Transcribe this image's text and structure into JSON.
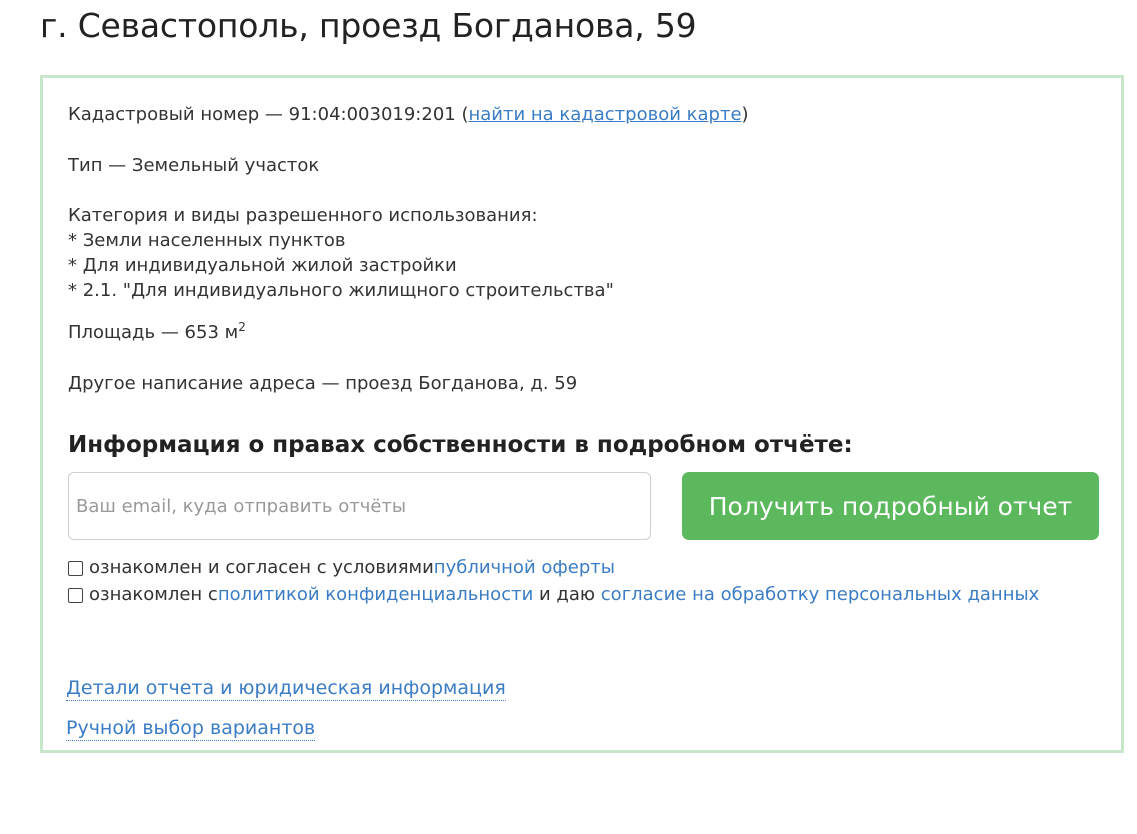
{
  "header": {
    "title": "г. Севастополь, проезд Богданова, 59"
  },
  "property": {
    "cadastral_label": "Кадастровый номер — 91:04:003019:201 (",
    "cadastral_link": "найти на кадастровой карте",
    "cadastral_close": ")",
    "type_line": "Тип — Земельный участок",
    "category_heading": "Категория и виды разрешенного использования:",
    "category_items": [
      "* Земли населенных пунктов",
      "* Для индивидуальной жилой застройки",
      "* 2.1. \"Для индивидуального жилищного строительства\""
    ],
    "area_label": "Площадь — 653 м",
    "area_sup": "2",
    "alt_address": "Другое написание адреса — проезд Богданова, д. 59"
  },
  "report": {
    "heading": "Информация о правах собственности в подробном отчёте:",
    "email_placeholder": "Ваш email, куда отправить отчёты",
    "email_value": "",
    "submit_label": "Получить подробный отчет"
  },
  "consent": {
    "offer_prefix": "ознакомлен и согласен с условиями ",
    "offer_link": "публичной оферты",
    "privacy_prefix": "ознакомлен с ",
    "privacy_link": "политикой конфиденциальности",
    "privacy_middle": " и даю ",
    "personal_data_link": "согласие на обработку персональных данных"
  },
  "footer": {
    "details_link": "Детали отчета и юридическая информация",
    "manual_link": "Ручной выбор вариантов"
  },
  "colors": {
    "accent_green": "#5cb85c",
    "card_border": "#c8e6c9",
    "link_blue": "#3b7cc4"
  }
}
